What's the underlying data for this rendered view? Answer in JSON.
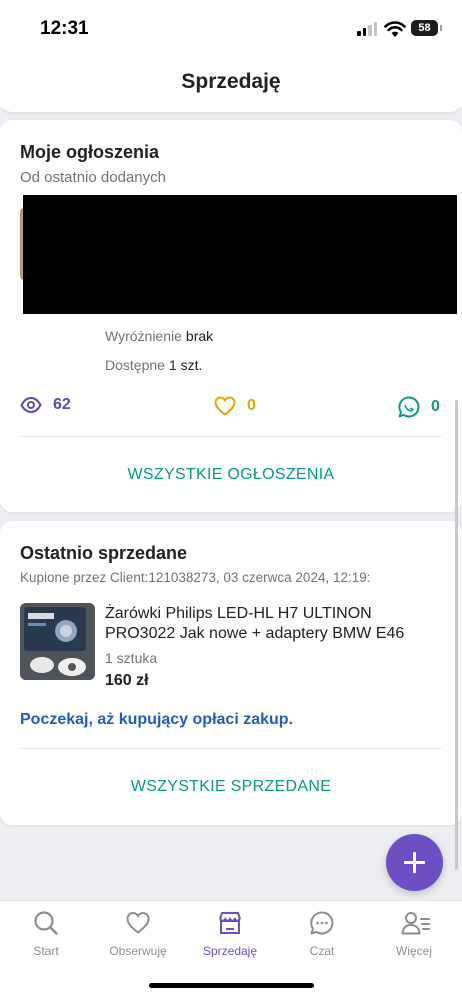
{
  "status_bar": {
    "time": "12:31",
    "battery": "58"
  },
  "header": {
    "title": "Sprzedaję"
  },
  "listings": {
    "title": "Moje ogłoszenia",
    "subtitle": "Od ostatnio dodanych",
    "highlight_label": "Wyróżnienie",
    "highlight_value": "brak",
    "available_label": "Dostępne",
    "available_value": "1 szt.",
    "views": "62",
    "likes": "0",
    "messages": "0",
    "all_button": "WSZYSTKIE OGŁOSZENIA"
  },
  "sold": {
    "title": "Ostatnio sprzedane",
    "buyer_line": "Kupione przez Client:121038273, 03 czerwca 2024, 12:19:",
    "item_title": "Żarówki Philips LED-HL H7 ULTINON PRO3022 Jak nowe + adaptery BMW E46",
    "quantity": "1 sztuka",
    "price": "160 zł",
    "note": "Poczekaj, aż kupujący opłaci zakup.",
    "all_button": "WSZYSTKIE SPRZEDANE"
  },
  "tabs": [
    {
      "label": "Start",
      "icon": "search-icon"
    },
    {
      "label": "Obserwuję",
      "icon": "heart-icon"
    },
    {
      "label": "Sprzedaję",
      "icon": "shop-icon",
      "active": true
    },
    {
      "label": "Czat",
      "icon": "chat-icon"
    },
    {
      "label": "Więcej",
      "icon": "user-menu-icon"
    }
  ],
  "colors": {
    "accent": "#6d4fc3",
    "link": "#0a9a88",
    "note": "#1f5fbf",
    "likes": "#e1a800",
    "views": "#5b4bb2"
  }
}
